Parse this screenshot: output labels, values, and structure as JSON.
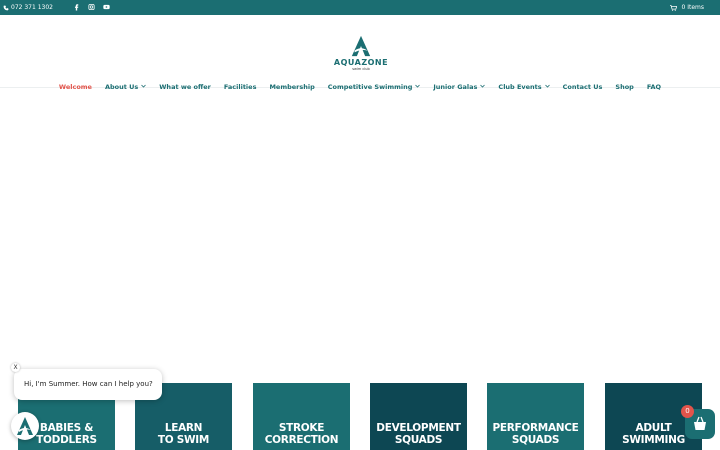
{
  "topbar": {
    "phone": "072 371 1302",
    "cart_label": "0 Items",
    "social": [
      "facebook-icon",
      "instagram-icon",
      "youtube-icon"
    ]
  },
  "logo": {
    "wordmark": "AQUAZONE",
    "subtitle": "swim club"
  },
  "nav": {
    "items": [
      {
        "label": "Welcome",
        "has_dropdown": false,
        "active": true
      },
      {
        "label": "About Us",
        "has_dropdown": true,
        "active": false
      },
      {
        "label": "What we offer",
        "has_dropdown": false,
        "active": false
      },
      {
        "label": "Facilities",
        "has_dropdown": false,
        "active": false
      },
      {
        "label": "Membership",
        "has_dropdown": false,
        "active": false
      },
      {
        "label": "Competitive Swimming",
        "has_dropdown": true,
        "active": false
      },
      {
        "label": "Junior Galas",
        "has_dropdown": true,
        "active": false
      },
      {
        "label": "Club Events",
        "has_dropdown": true,
        "active": false
      },
      {
        "label": "Contact Us",
        "has_dropdown": false,
        "active": false
      },
      {
        "label": "Shop",
        "has_dropdown": false,
        "active": false
      },
      {
        "label": "FAQ",
        "has_dropdown": false,
        "active": false
      }
    ]
  },
  "tiles": [
    {
      "line1": "BABIES &",
      "line2": "TODDLERS",
      "color": "#1b6e72"
    },
    {
      "line1": "LEARN",
      "line2": "TO SWIM",
      "color": "#165d67"
    },
    {
      "line1": "STROKE",
      "line2": "CORRECTION",
      "color": "#1b6e72"
    },
    {
      "line1": "DEVELOPMENT",
      "line2": "SQUADS",
      "color": "#0d4753"
    },
    {
      "line1": "PERFORMANCE",
      "line2": "SQUADS",
      "color": "#1b6e72"
    },
    {
      "line1": "ADULT",
      "line2": "SWIMMING",
      "color": "#0d4753"
    }
  ],
  "chat": {
    "message": "Hi, I'm Summer. How can I help you?",
    "close_label": "X"
  },
  "cart_widget": {
    "count": "0"
  },
  "colors": {
    "brand_teal": "#1b6e72",
    "accent_red": "#e2544b"
  }
}
